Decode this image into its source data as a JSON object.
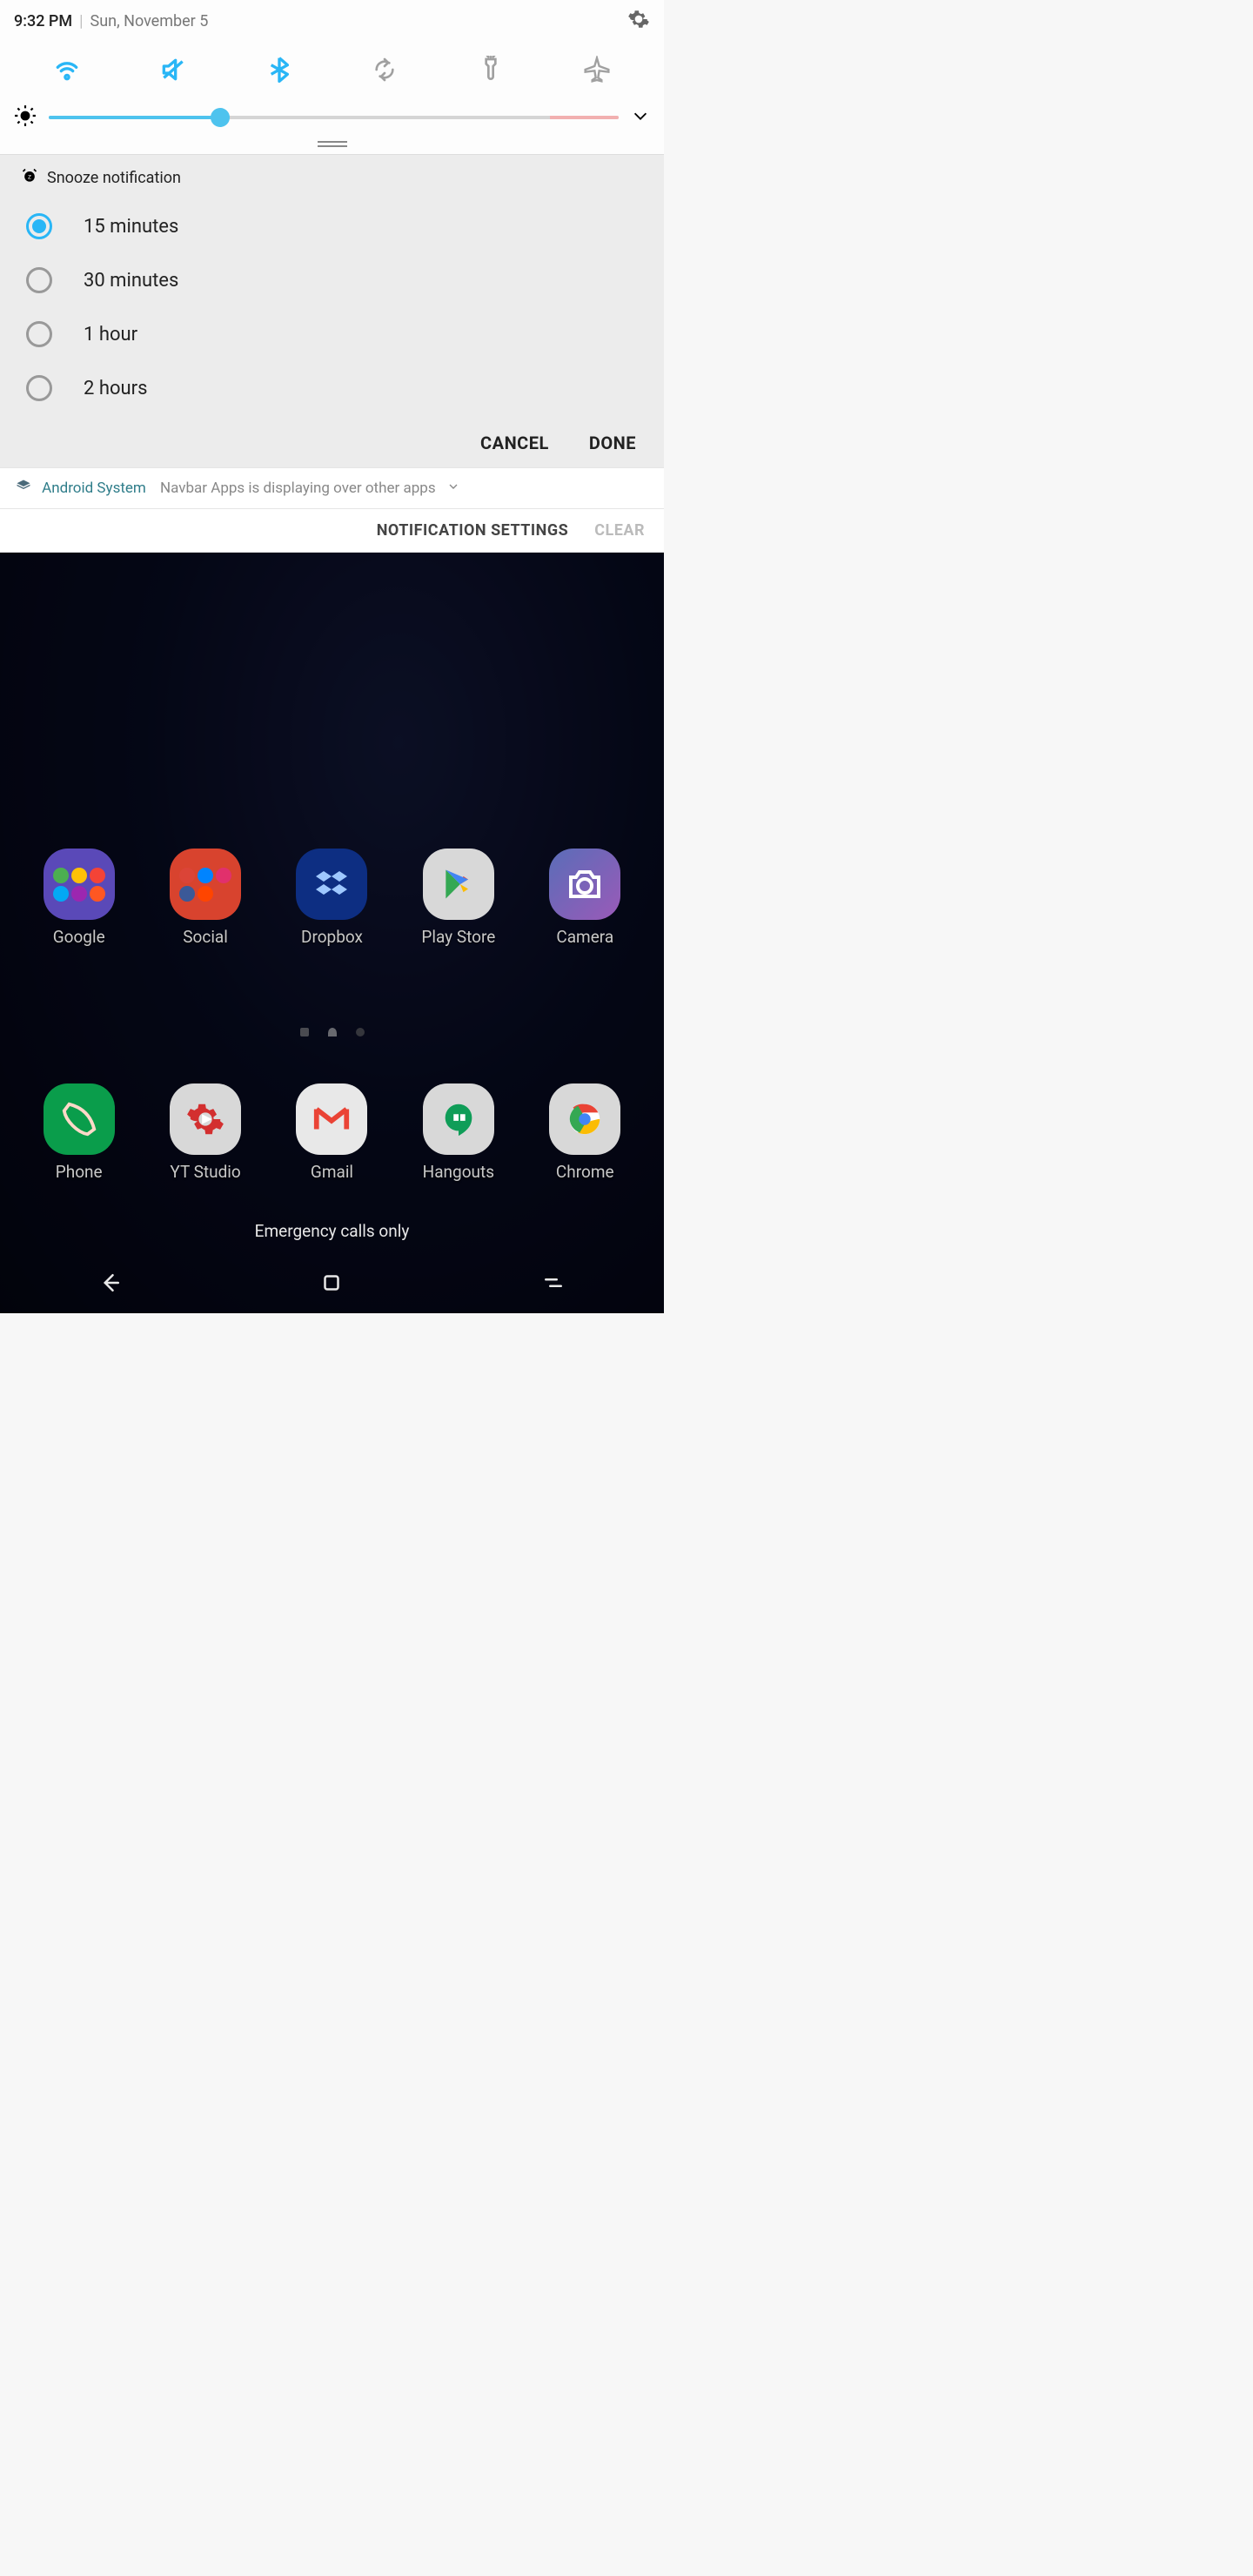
{
  "status": {
    "time": "9:32 PM",
    "date": "Sun, November 5"
  },
  "quick_settings": {
    "wifi_on": true,
    "mute_on": true,
    "bluetooth_on": true,
    "rotate_on": false,
    "flashlight_on": false,
    "airplane_on": false
  },
  "brightness_percent": 30,
  "snooze": {
    "title": "Snooze notification",
    "options": [
      "15 minutes",
      "30 minutes",
      "1 hour",
      "2 hours"
    ],
    "selected_index": 0,
    "cancel_label": "CANCEL",
    "done_label": "DONE"
  },
  "system_notif": {
    "app": "Android System",
    "message": "Navbar Apps is displaying over other apps"
  },
  "footer": {
    "settings_label": "NOTIFICATION SETTINGS",
    "clear_label": "CLEAR"
  },
  "home": {
    "row1": [
      "Google",
      "Social",
      "Dropbox",
      "Play Store",
      "Camera"
    ],
    "row2": [
      "Phone",
      "YT Studio",
      "Gmail",
      "Hangouts",
      "Chrome"
    ],
    "emergency": "Emergency calls only"
  },
  "colors": {
    "accent": "#29b6f6"
  }
}
